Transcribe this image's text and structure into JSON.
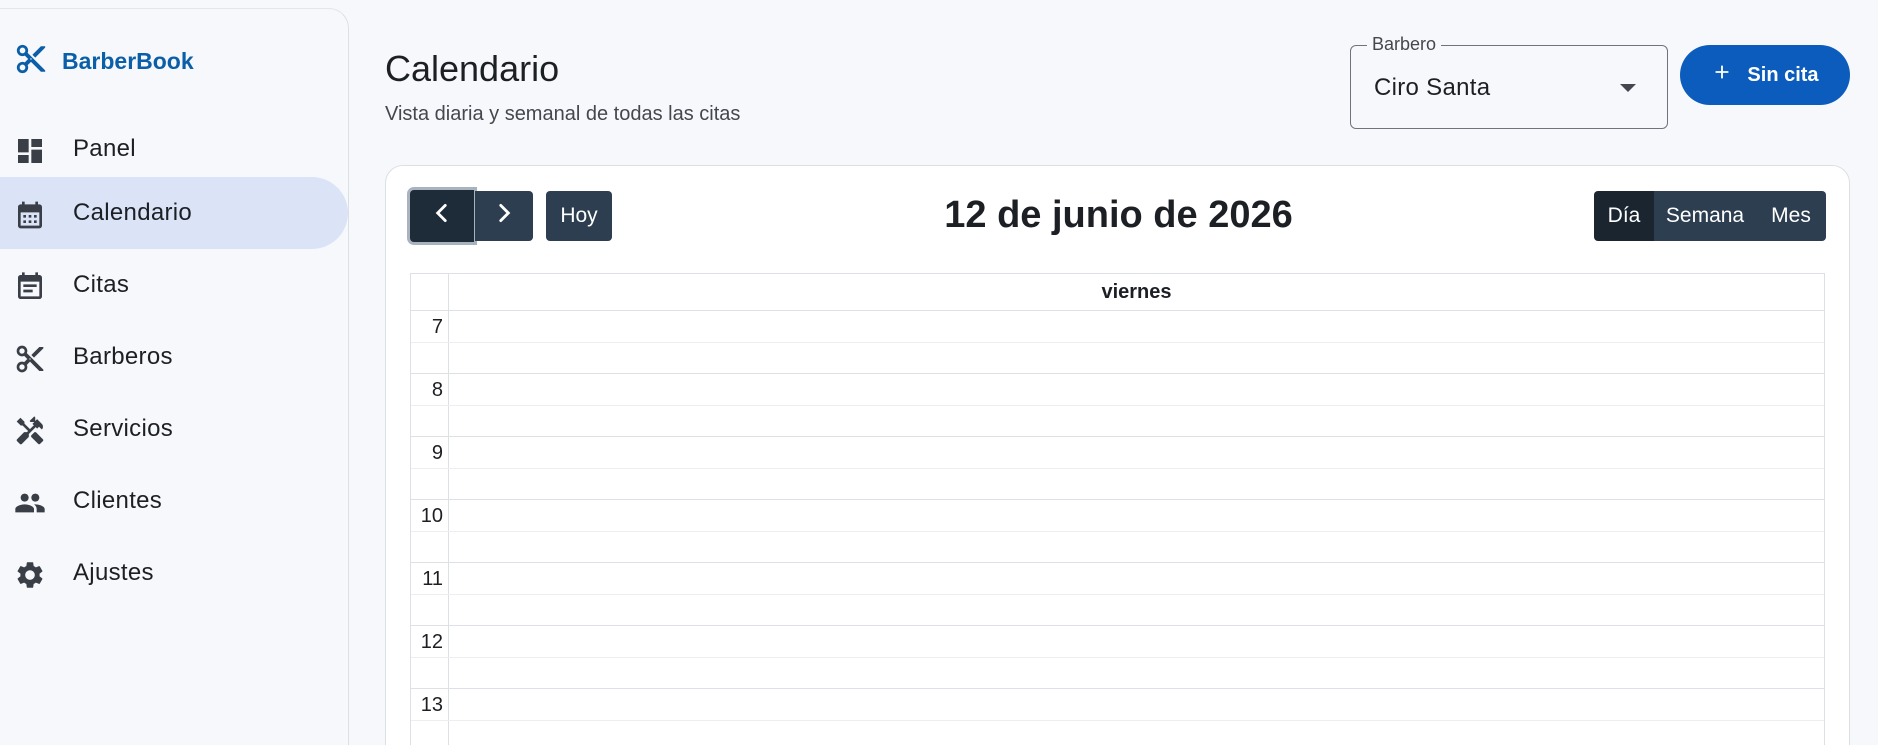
{
  "app": {
    "name": "BarberBook",
    "brand_color": "#0b5fa8"
  },
  "sidebar": {
    "items": [
      {
        "label": "Panel",
        "icon": "dashboard-icon",
        "active": false
      },
      {
        "label": "Calendario",
        "icon": "calendar-icon",
        "active": true
      },
      {
        "label": "Citas",
        "icon": "event-note-icon",
        "active": false
      },
      {
        "label": "Barberos",
        "icon": "scissors-icon",
        "active": false
      },
      {
        "label": "Servicios",
        "icon": "tools-icon",
        "active": false
      },
      {
        "label": "Clientes",
        "icon": "people-icon",
        "active": false
      },
      {
        "label": "Ajustes",
        "icon": "gear-icon",
        "active": false
      }
    ]
  },
  "header": {
    "title": "Calendario",
    "subtitle": "Vista diaria y semanal de todas las citas",
    "barber_select": {
      "label": "Barbero",
      "value": "Ciro Santa"
    },
    "new_button": {
      "label": "Sin cita",
      "icon": "plus-icon",
      "color": "#0b5cbc"
    }
  },
  "calendar": {
    "today_label": "Hoy",
    "date_title": "12 de junio de 2026",
    "views": [
      {
        "label": "Día",
        "active": true
      },
      {
        "label": "Semana",
        "active": false
      },
      {
        "label": "Mes",
        "active": false
      }
    ],
    "day_label": "viernes",
    "hours": [
      "7",
      "8",
      "9",
      "10",
      "11",
      "12",
      "13"
    ]
  }
}
